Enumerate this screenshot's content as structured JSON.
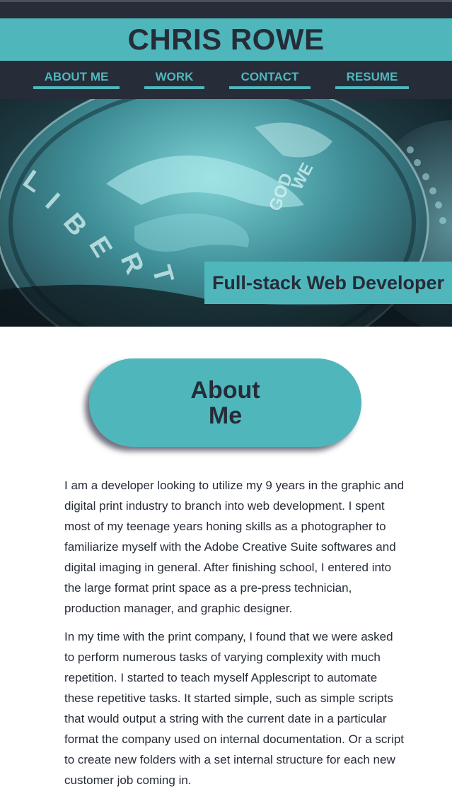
{
  "site": {
    "title": "CHRIS ROWE"
  },
  "nav": {
    "items": [
      {
        "label": "ABOUT ME"
      },
      {
        "label": "WORK"
      },
      {
        "label": "CONTACT"
      },
      {
        "label": "RESUME"
      }
    ]
  },
  "hero": {
    "image": "coin-closeup-photo",
    "tagline": "Full-stack Web Developer"
  },
  "about": {
    "heading": "About Me",
    "paragraphs": [
      "I am a developer looking to utilize my 9 years in the graphic and digital print industry to branch into web development. I spent most of my teenage years honing skills as a photographer to familiarize myself with the Adobe Creative Suite softwares and digital imaging in general. After finishing school, I entered into the large format print space as a pre-press technician, production manager, and graphic designer.",
      "In my time with the print company, I found that we were asked to perform numerous tasks of varying complexity with much repetition. I started to teach myself Applescript to automate these repetitive tasks. It started simple, such as simple scripts that would output a string with the current date in a particular format the company used on internal documentation. Or a script to create new folders with a set internal structure for each new customer job coming in."
    ]
  },
  "colors": {
    "accent": "#4fb7bc",
    "dark": "#262c38",
    "background": "#ffffff"
  }
}
